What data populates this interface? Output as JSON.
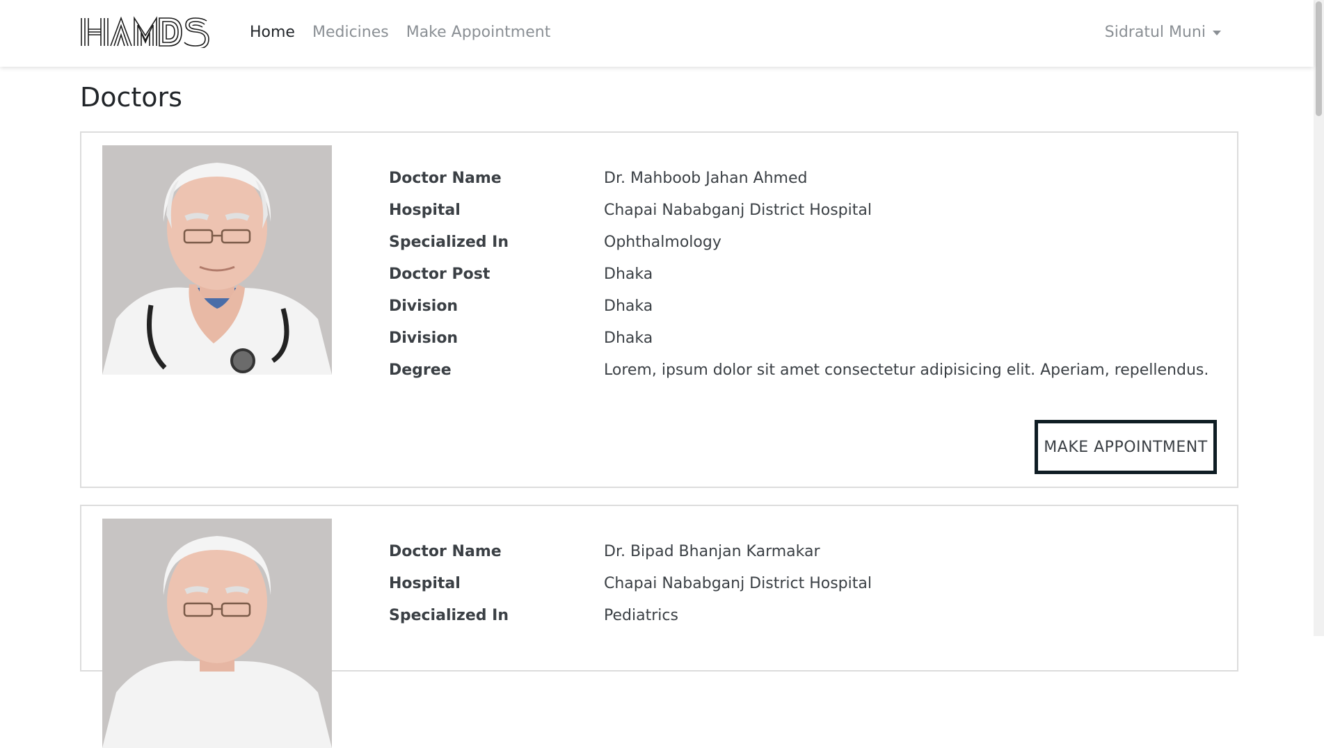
{
  "navbar": {
    "brand": "HAMDS",
    "links": [
      {
        "label": "Home",
        "active": true
      },
      {
        "label": "Medicines",
        "active": false
      },
      {
        "label": "Make Appointment",
        "active": false
      }
    ],
    "user_name": "Sidratul Muni"
  },
  "page": {
    "title": "Doctors"
  },
  "doctors": [
    {
      "rows": [
        {
          "label": "Doctor Name",
          "value": "Dr. Mahboob Jahan Ahmed"
        },
        {
          "label": "Hospital",
          "value": "Chapai Nababganj District Hospital"
        },
        {
          "label": "Specialized In",
          "value": "Ophthalmology"
        },
        {
          "label": "Doctor Post",
          "value": "Dhaka"
        },
        {
          "label": "Division",
          "value": "Dhaka"
        },
        {
          "label": "Division",
          "value": "Dhaka"
        },
        {
          "label": "Degree",
          "value": "Lorem, ipsum dolor sit amet consectetur adipisicing elit. Aperiam, repellendus."
        }
      ],
      "button_label": "MAKE APPOINTMENT"
    },
    {
      "rows": [
        {
          "label": "Doctor Name",
          "value": "Dr. Bipad Bhanjan Karmakar"
        },
        {
          "label": "Hospital",
          "value": "Chapai Nababganj District Hospital"
        },
        {
          "label": "Specialized In",
          "value": "Pediatrics"
        }
      ]
    }
  ],
  "colors": {
    "nav_text_muted": "#8a8f94",
    "nav_text_active": "#212529",
    "button_border": "#0f1d24",
    "card_border": "#dcdcdc"
  }
}
